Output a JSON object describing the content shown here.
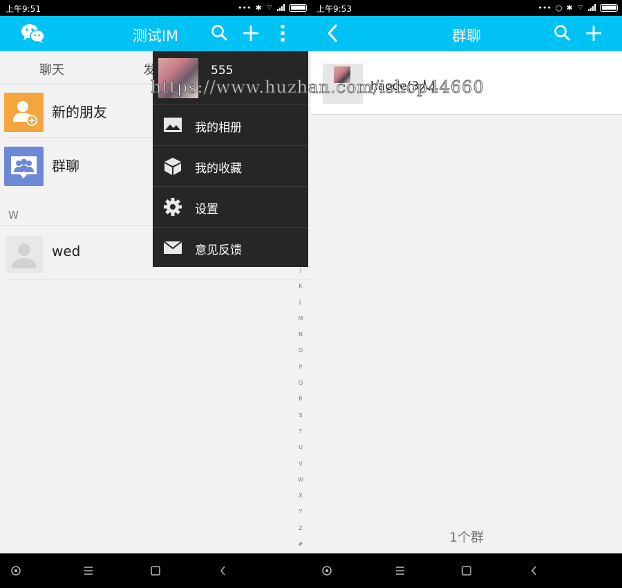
{
  "left": {
    "status_time": "上午9:51",
    "title": "测试IM",
    "tabs": [
      "聊天",
      "发"
    ],
    "contacts": [
      {
        "name": "新的朋友",
        "icon": "add-friend-icon",
        "color": "#f4a53d"
      },
      {
        "name": "群聊",
        "icon": "group-chat-icon",
        "color": "#6d89d5"
      }
    ],
    "section_letter": "W",
    "section_contacts": [
      {
        "name": "wed",
        "icon": "default-avatar-icon"
      }
    ],
    "alpha_index": [
      "J",
      "K",
      "L",
      "M",
      "N",
      "O",
      "P",
      "Q",
      "R",
      "S",
      "T",
      "U",
      "V",
      "W",
      "X",
      "Y",
      "Z",
      "#"
    ],
    "menu": {
      "user_name": "555",
      "items": [
        {
          "label": "我的相册",
          "icon": "image-icon"
        },
        {
          "label": "我的收藏",
          "icon": "cube-icon"
        },
        {
          "label": "设置",
          "icon": "gear-icon"
        },
        {
          "label": "意见反馈",
          "icon": "mail-icon"
        }
      ]
    }
  },
  "right": {
    "status_time": "上午9:53",
    "title": "群聊",
    "groups": [
      {
        "name": "haode(3人)"
      }
    ],
    "group_count": "1个群"
  },
  "watermark": "https://www.huzhan.com/ishop44660",
  "colors": {
    "accent": "#00c2f5",
    "menu_bg": "#262626"
  }
}
